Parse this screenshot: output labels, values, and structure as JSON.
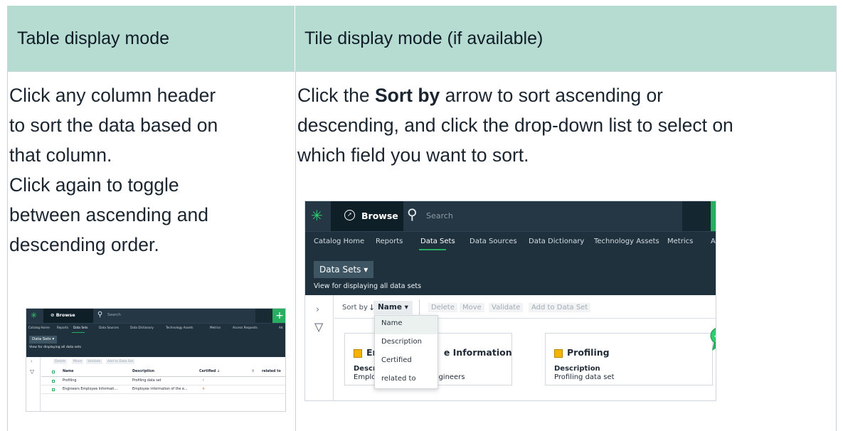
{
  "table": {
    "headers": [
      "Table display mode",
      "Tile display mode (if available)"
    ],
    "cell1_lines": [
      "Click any column header",
      "to sort the data based on",
      "that column.",
      "Click again to toggle",
      "between ascending and",
      "descending order."
    ],
    "cell2_pre": "Click the ",
    "cell2_bold": "Sort by",
    "cell2_post": " arrow to sort ascending or",
    "cell2_line2": "descending, and click the drop-down list to select on",
    "cell2_line3": "which field you want to sort."
  },
  "small_shot": {
    "browse": "Browse",
    "search": "Search",
    "nav": [
      "Catalog Home",
      "Reports",
      "Data Sets",
      "Data Sources",
      "Data Dictionary",
      "Technology Assets",
      "Metrics",
      "Access Requests",
      "Ad"
    ],
    "data_sets_btn": "Data Sets ▾",
    "view_text": "View for displaying all data sets",
    "toolbar": [
      "Delete",
      "Move",
      "Validate",
      "Add to Data Set"
    ],
    "columns": [
      "Name",
      "Description",
      "Certified ↓",
      "related to"
    ],
    "rows": [
      {
        "name": "Profiling",
        "description": "Profiling data set",
        "certified": "✓"
      },
      {
        "name": "Engineers Employee Informati...",
        "description": "Employee information of the e...",
        "certified": "×"
      }
    ]
  },
  "large_shot": {
    "browse": "Browse",
    "search": "Search",
    "nav": [
      "Catalog Home",
      "Reports",
      "Data Sets",
      "Data Sources",
      "Data Dictionary",
      "Technology Assets",
      "Metrics",
      "Access R"
    ],
    "data_sets_btn": "Data Sets ▾",
    "view_text": "View for displaying all data sets",
    "sort_by": "Sort by",
    "sort_arrow": "↓",
    "sort_field": "Name ▾",
    "toolbar": [
      "Delete",
      "Move",
      "Validate",
      "Add to Data Set"
    ],
    "dropdown": [
      "Name",
      "Description",
      "Certified",
      "related to"
    ],
    "cards": [
      {
        "title": "En                     e Information",
        "desc_label": "Descri",
        "desc_value": "Employ                   e engineers"
      },
      {
        "title": "Profiling",
        "desc_label": "Description",
        "desc_value": "Profiling data set"
      }
    ]
  },
  "colors": {
    "header_bg": "#b6dcd2",
    "app_dark": "#253744",
    "app_nav": "#1f313d",
    "accent_green": "#27ae60"
  }
}
